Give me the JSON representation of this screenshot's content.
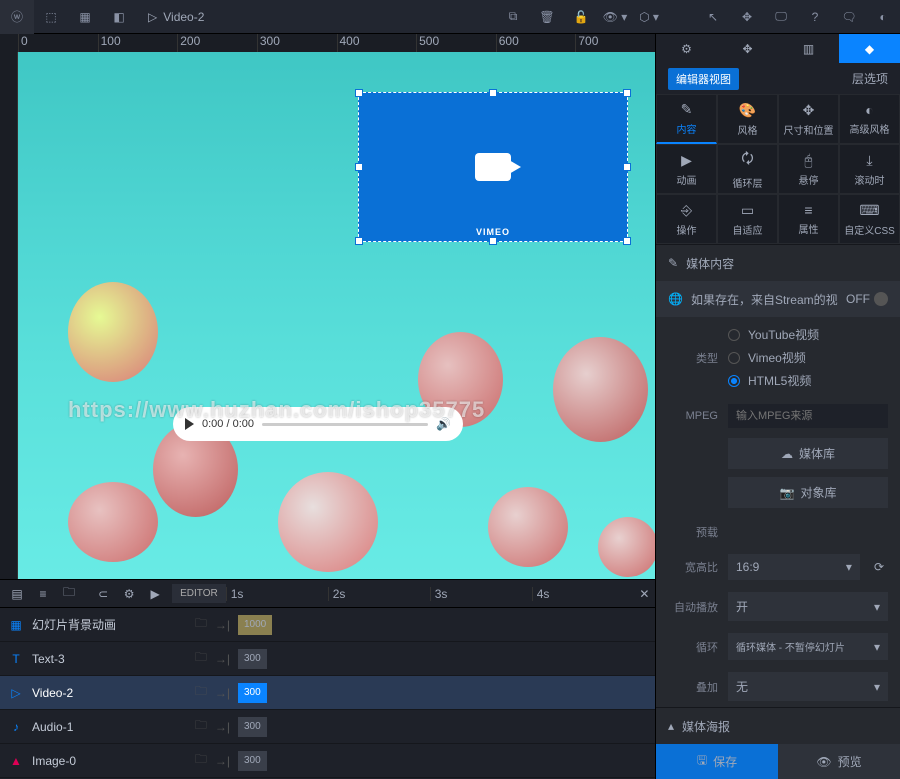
{
  "topbar": {
    "title": "Video-2"
  },
  "ruler": {
    "marks": [
      "0",
      "100",
      "200",
      "300",
      "400",
      "500",
      "600",
      "700"
    ]
  },
  "selection": {
    "label": "VIMEO"
  },
  "watermark": "https://www.huzhan.com/ishop35775",
  "player": {
    "time": "0:00 / 0:00"
  },
  "timeline": {
    "editor_label": "EDITOR",
    "ticks": [
      "1s",
      "2s",
      "3s",
      "4s"
    ],
    "rows": [
      {
        "icon": "▦",
        "label": "幻灯片背景动画",
        "bar": "1000",
        "barClass": "yellow",
        "iconColor": "#0a84ff"
      },
      {
        "icon": "T",
        "label": "Text-3",
        "bar": "300",
        "barClass": "",
        "iconColor": "#0a84ff"
      },
      {
        "icon": "▷",
        "label": "Video-2",
        "bar": "300",
        "barClass": "blue",
        "active": true,
        "iconColor": "#0a84ff"
      },
      {
        "icon": "♪",
        "label": "Audio-1",
        "bar": "300",
        "barClass": "",
        "iconColor": "#0a84ff"
      },
      {
        "icon": "▲",
        "label": "Image-0",
        "bar": "300",
        "barClass": "",
        "iconColor": "#d05"
      }
    ]
  },
  "panel": {
    "badge": "编辑器视图",
    "layers_link": "层选项",
    "grid": [
      {
        "icon": "✎",
        "label": "内容",
        "active": true
      },
      {
        "icon": "🎨",
        "label": "风格"
      },
      {
        "icon": "✥",
        "label": "尺寸和位置"
      },
      {
        "icon": "◐",
        "label": "高级风格"
      },
      {
        "icon": "▶",
        "label": "动画"
      },
      {
        "icon": "🗘",
        "label": "循环层"
      },
      {
        "icon": "🖰",
        "label": "悬停"
      },
      {
        "icon": "⤓",
        "label": "滚动时"
      },
      {
        "icon": "⎆",
        "label": "操作"
      },
      {
        "icon": "▭",
        "label": "自适应"
      },
      {
        "icon": "≡",
        "label": "属性"
      },
      {
        "icon": "⌨",
        "label": "自定义CSS"
      }
    ],
    "media_section": "媒体内容",
    "stream_row": "如果存在，来自Stream的视",
    "off_label": "OFF",
    "type_label": "类型",
    "type_options": [
      {
        "label": "YouTube视频",
        "checked": false
      },
      {
        "label": "Vimeo视频",
        "checked": false
      },
      {
        "label": "HTML5视频",
        "checked": true
      }
    ],
    "mpeg_label": "MPEG",
    "mpeg_placeholder": "输入MPEG来源",
    "media_lib": "媒体库",
    "object_lib": "对象库",
    "preload_label": "预载",
    "aspect_label": "宽高比",
    "aspect_value": "16:9",
    "autoplay_label": "自动播放",
    "autoplay_value": "开",
    "loop_label": "循环",
    "loop_value": "循环媒体 - 不暂停幻灯片",
    "overlay_label": "叠加",
    "overlay_value": "无",
    "poster_section": "媒体海报",
    "save": "保存",
    "preview": "预览"
  }
}
